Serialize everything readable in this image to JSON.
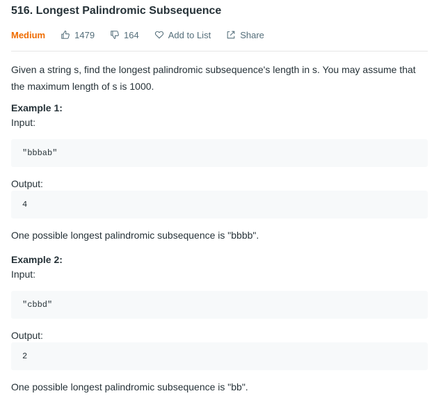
{
  "problem": {
    "title": "516. Longest Palindromic Subsequence",
    "difficulty": "Medium",
    "likes": "1479",
    "dislikes": "164",
    "add_to_list_label": "Add to List",
    "share_label": "Share"
  },
  "description": {
    "text": "Given a string s, find the longest palindromic subsequence's length in s. You may assume that the maximum length of s is 1000."
  },
  "examples": [
    {
      "heading": "Example 1:",
      "input_label": "Input:",
      "input_value": "\"bbbab\"",
      "output_label": "Output:",
      "output_value": "4",
      "explanation": "One possible longest palindromic subsequence is \"bbbb\"."
    },
    {
      "heading": "Example 2:",
      "input_label": "Input:",
      "input_value": "\"cbbd\"",
      "output_label": "Output:",
      "output_value": "2",
      "explanation": "One possible longest palindromic subsequence is \"bb\"."
    }
  ],
  "colors": {
    "difficulty_medium": "#ef6c00",
    "text": "#263238",
    "muted": "#546e7a",
    "code_background": "#f7f9fa"
  },
  "icons": {
    "likes": "thumbs-up-icon",
    "dislikes": "thumbs-down-icon",
    "add_to_list": "heart-icon",
    "share": "share-icon"
  }
}
